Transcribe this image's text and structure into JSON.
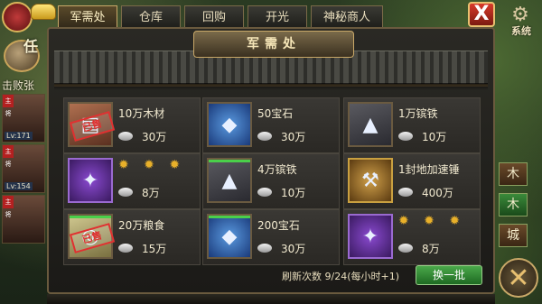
{
  "hud": {
    "task_label": "任",
    "defeat_label": "击败张",
    "heroes": [
      {
        "level": "Lv:171",
        "tag": "主将"
      },
      {
        "level": "Lv:154",
        "tag": "主将"
      },
      {
        "level": "",
        "tag": "主将"
      }
    ]
  },
  "tabs": [
    {
      "label": "军需处",
      "active": true
    },
    {
      "label": "仓库",
      "active": false
    },
    {
      "label": "回购",
      "active": false
    },
    {
      "label": "开光",
      "active": false
    },
    {
      "label": "神秘商人",
      "active": false
    }
  ],
  "close_label": "X",
  "system_label": "系统",
  "panel": {
    "title": "军需处"
  },
  "items": [
    {
      "name": "10万木材",
      "price": "30万",
      "sold": true,
      "sold_label": "已售",
      "stars": false,
      "icon": "wood"
    },
    {
      "name": "50宝石",
      "price": "30万",
      "sold": false,
      "stars": false,
      "icon": "gem"
    },
    {
      "name": "1万镔铁",
      "price": "10万",
      "sold": false,
      "stars": false,
      "icon": "iron"
    },
    {
      "name": "",
      "price": "8万",
      "sold": false,
      "stars": true,
      "star_text": "✹ ✹ ✹",
      "icon": "purple-weapon"
    },
    {
      "name": "4万镔铁",
      "price": "10万",
      "sold": false,
      "stars": false,
      "icon": "iron",
      "green_bar": true
    },
    {
      "name": "1封地加速锤",
      "price": "400万",
      "sold": false,
      "stars": false,
      "icon": "hammer"
    },
    {
      "name": "20万粮食",
      "price": "15万",
      "sold": true,
      "sold_label": "已售",
      "stars": false,
      "icon": "grain",
      "green_bar": true
    },
    {
      "name": "200宝石",
      "price": "30万",
      "sold": false,
      "stars": false,
      "icon": "gem",
      "green_bar": true
    },
    {
      "name": "",
      "price": "8万",
      "sold": false,
      "stars": true,
      "star_text": "✹ ✹ ✹",
      "icon": "purple-weapon"
    }
  ],
  "footer": {
    "refresh_text": "刷新次数 9/24(每小时+1)",
    "refresh_button": "换一批"
  },
  "side_buttons": [
    "木",
    "木",
    "城"
  ],
  "big_close": "✕"
}
